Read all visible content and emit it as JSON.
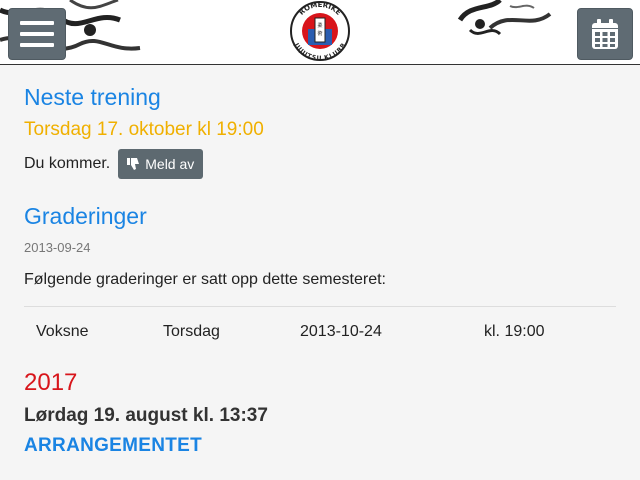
{
  "header": {
    "menu_icon": "hamburger-menu-icon",
    "calendar_icon": "calendar-icon",
    "logo_text_top": "ROMERIKE",
    "logo_text_bottom": "JUJUTSU KLUBB"
  },
  "next_training": {
    "heading": "Neste trening",
    "datetime": "Torsdag 17. oktober kl 19:00",
    "status": "Du kommer.",
    "button_label": "Meld av"
  },
  "gradings": {
    "heading": "Graderinger",
    "date": "2013-09-24",
    "intro": "Følgende graderinger er satt opp dette semesteret:",
    "rows": [
      {
        "group": "Voksne",
        "weekday": "Torsdag",
        "date": "2013-10-24",
        "time": "kl. 19:00"
      }
    ]
  },
  "event": {
    "year": "2017",
    "date": "Lørdag 19. august kl. 13:37",
    "title": "ARRANGEMENTET"
  },
  "colors": {
    "heading_blue": "#1a84e3",
    "date_orange": "#f0b000",
    "year_red": "#d8151b",
    "button_grey": "#5d6970"
  }
}
